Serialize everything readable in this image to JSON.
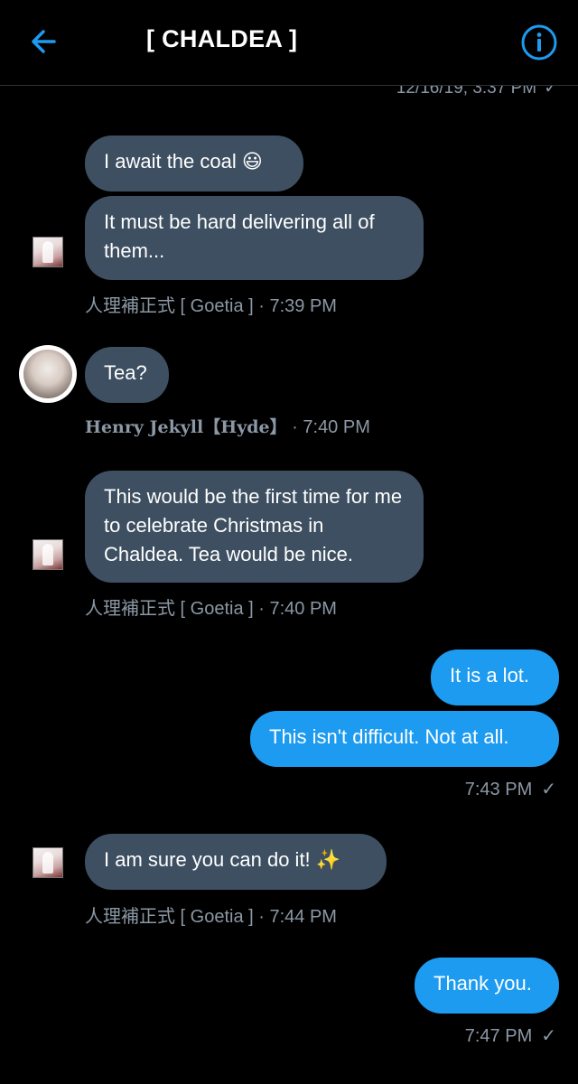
{
  "header": {
    "title": "[ CHALDEA ]",
    "back_icon": "arrow-left-icon",
    "info_icon": "info-circle-icon",
    "accent_color": "#1d9bf0"
  },
  "top_stamp": {
    "time": "12/16/19, 3:37 PM",
    "check": "✓"
  },
  "messages": [
    {
      "text": "I await the coal 😃"
    },
    {
      "text": "It must be hard delivering all of them..."
    },
    {
      "meta": "人理補正式 [ Goetia ] · 7:39 PM"
    },
    {
      "text": "Tea?"
    },
    {
      "sender": "Henry Jekyll【Hyde】",
      "time": " · 7:40 PM"
    },
    {
      "text": "This would be the first time for me to celebrate Christmas in Chaldea. Tea would be nice."
    },
    {
      "meta": "人理補正式 [ Goetia ] · 7:40 PM"
    },
    {
      "text": "It is a lot."
    },
    {
      "text": "This isn't difficult. Not at all."
    },
    {
      "time": "7:43 PM",
      "check": "✓"
    },
    {
      "text": "I am sure you can do it!  ✨"
    },
    {
      "meta": "人理補正式 [ Goetia ] · 7:44 PM"
    },
    {
      "text": "Thank you."
    },
    {
      "time": "7:47 PM",
      "check": "✓"
    }
  ],
  "colors": {
    "incoming_bubble": "#3d4f61",
    "outgoing_bubble": "#1d9bf0",
    "meta_text": "#8b98a5",
    "background": "#000000"
  }
}
